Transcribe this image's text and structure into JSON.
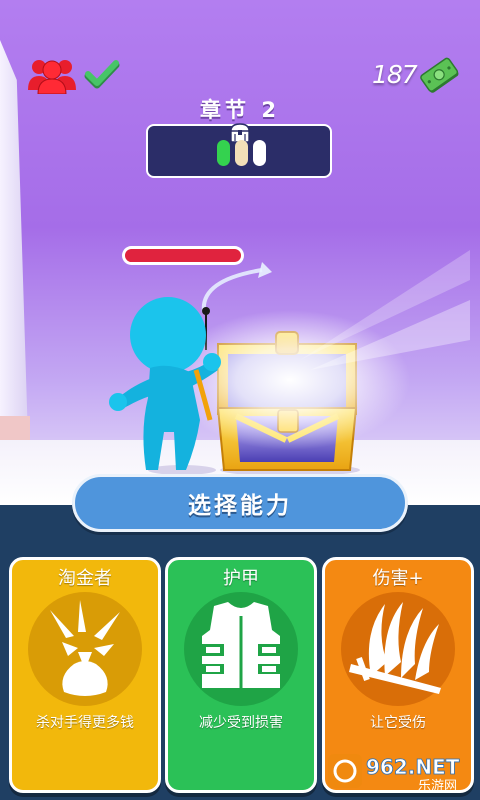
{
  "hud": {
    "money": "187",
    "chapter_title": "章节 2"
  },
  "level_progress": {
    "stages": [
      "done",
      "current",
      "upcoming"
    ],
    "colors": {
      "done": "#34d24f",
      "current": "#f3dfb8",
      "upcoming": "#ffffff"
    }
  },
  "enemy": {
    "health_fraction": 1.0,
    "health_color": "#e0233e"
  },
  "select_banner": {
    "label": "选择能力"
  },
  "abilities": [
    {
      "title": "淘金者",
      "description": "杀对手得更多钱",
      "icon": "money-bag-icon",
      "color": "#f2b80c",
      "circle_color": "#d99c06"
    },
    {
      "title": "护甲",
      "description": "减少受到损害",
      "icon": "armor-vest-icon",
      "color": "#2bc157",
      "circle_color": "#1fa446"
    },
    {
      "title": "伤害+",
      "description": "让它受伤",
      "icon": "slash-damage-icon",
      "color": "#f48912",
      "circle_color": "#d96e08"
    }
  ],
  "watermark": {
    "text": "962.NET",
    "subtext": "乐游网"
  }
}
